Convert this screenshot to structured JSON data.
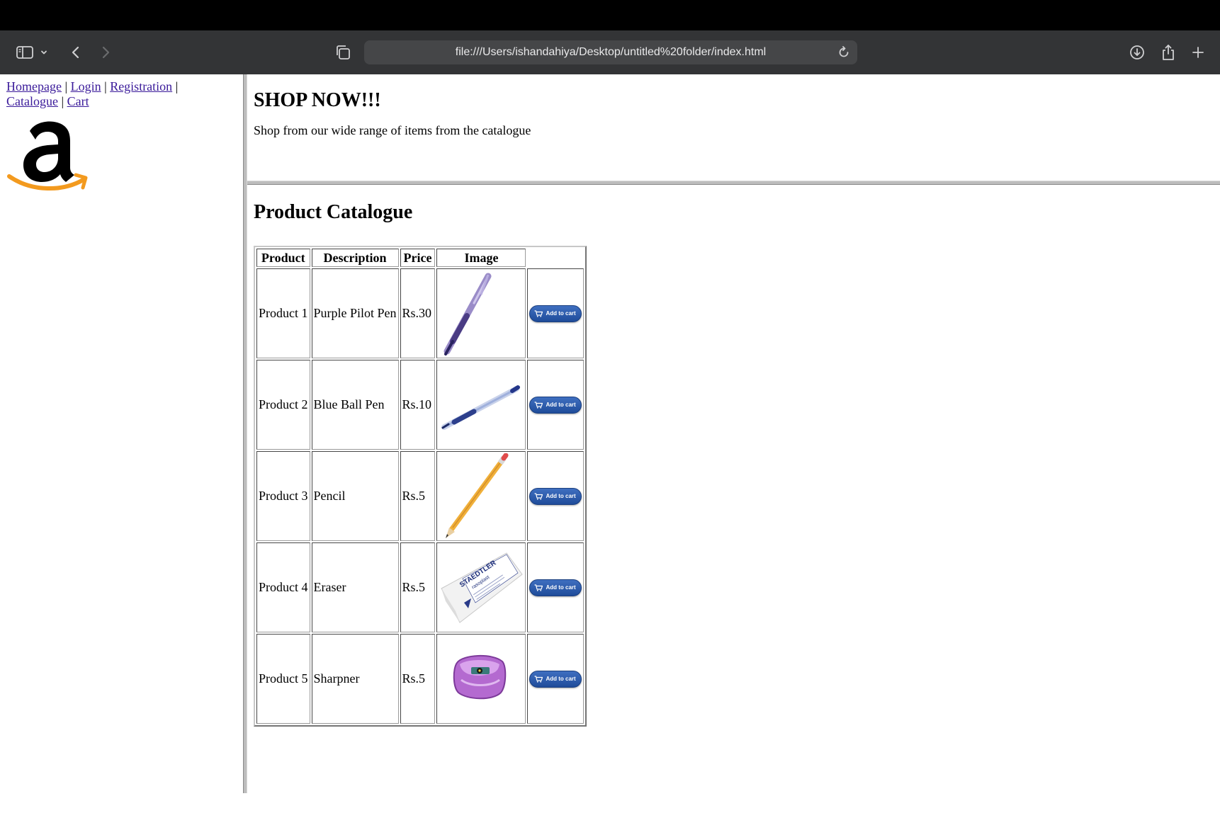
{
  "browser": {
    "url": "file:///Users/ishandahiya/Desktop/untitled%20folder/index.html"
  },
  "nav": {
    "links": [
      "Homepage",
      "Login",
      "Registration",
      "Catalogue",
      "Cart"
    ],
    "separator": "|"
  },
  "header": {
    "title": "SHOP NOW!!!",
    "tagline": "Shop from our wide range of items from the catalogue"
  },
  "catalogue": {
    "title": "Product Catalogue",
    "columns": [
      "Product",
      "Description",
      "Price",
      "Image"
    ],
    "rows": [
      {
        "product": "Product 1",
        "description": "Purple Pilot Pen",
        "price": "Rs.30",
        "image": "purple-pen-image"
      },
      {
        "product": "Product 2",
        "description": "Blue Ball Pen",
        "price": "Rs.10",
        "image": "blue-pen-image"
      },
      {
        "product": "Product 3",
        "description": "Pencil",
        "price": "Rs.5",
        "image": "pencil-image"
      },
      {
        "product": "Product 4",
        "description": "Eraser",
        "price": "Rs.5",
        "image": "eraser-image"
      },
      {
        "product": "Product 5",
        "description": "Sharpner",
        "price": "Rs.5",
        "image": "sharpener-image"
      }
    ],
    "add_to_cart_label": "Add to cart",
    "eraser_brand": "STAEDTLER",
    "eraser_model": "rasoplast"
  },
  "colors": {
    "link": "#3a1a9a",
    "toolbar": "#333436",
    "cart_button": "#2a58a8",
    "logo_orange": "#f39a1e"
  }
}
